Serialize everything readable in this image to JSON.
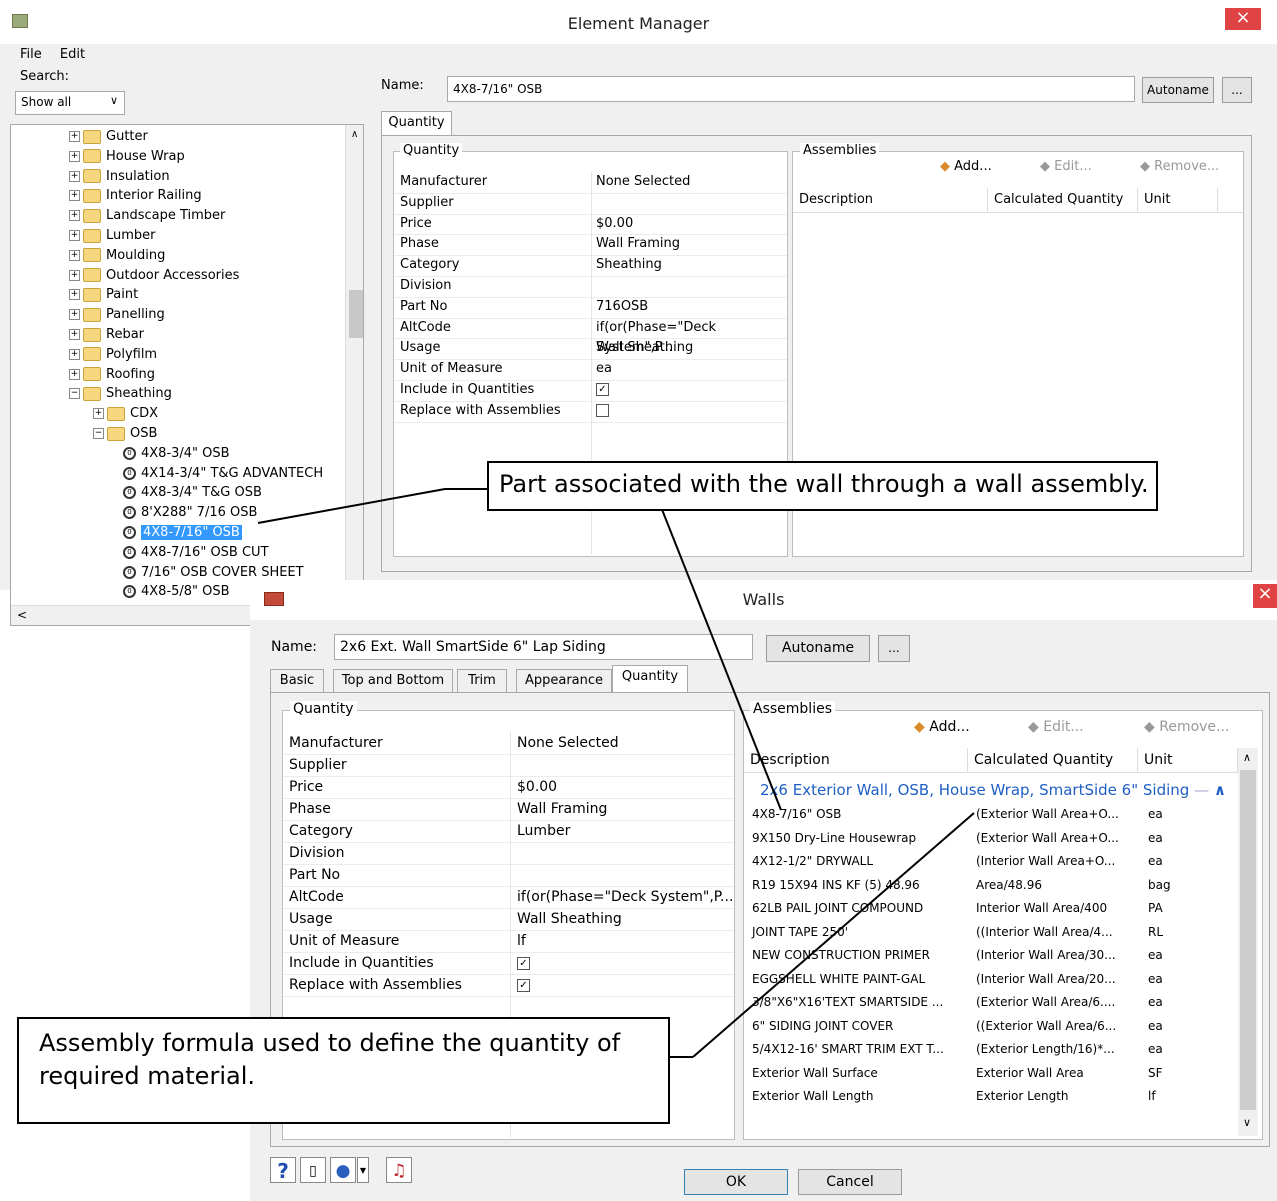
{
  "element_manager": {
    "title": "Element Manager",
    "menu": [
      "File",
      "Edit"
    ],
    "search_label": "Search:",
    "search_filter": "Show all",
    "name_label": "Name:",
    "name_value": "4X8-7/16\" OSB",
    "autoname": "Autoname",
    "ellipsis": "...",
    "tab": "Quantity",
    "quantity_group": "Quantity",
    "assemblies_group": "Assemblies",
    "add": "Add...",
    "edit": "Edit...",
    "remove": "Remove...",
    "col_description": "Description",
    "col_quantity": "Calculated Quantity",
    "col_unit": "Unit",
    "properties": [
      {
        "name": "Manufacturer",
        "value": "None Selected"
      },
      {
        "name": "Supplier",
        "value": ""
      },
      {
        "name": "Price",
        "value": "$0.00"
      },
      {
        "name": "Phase",
        "value": "Wall Framing"
      },
      {
        "name": "Category",
        "value": "Sheathing"
      },
      {
        "name": "Division",
        "value": ""
      },
      {
        "name": "Part No",
        "value": "716OSB"
      },
      {
        "name": "AltCode",
        "value": "if(or(Phase=\"Deck System\",P..."
      },
      {
        "name": "Usage",
        "value": "Wall Sheathing"
      },
      {
        "name": "Unit of Measure",
        "value": "ea"
      },
      {
        "name": "Include in Quantities",
        "value": "",
        "checkbox": true,
        "checked": true
      },
      {
        "name": "Replace with Assemblies",
        "value": "",
        "checkbox": true,
        "checked": false
      }
    ],
    "tree": [
      {
        "label": "Gutter",
        "type": "folder",
        "expander": "+"
      },
      {
        "label": "House Wrap",
        "type": "folder",
        "expander": "+"
      },
      {
        "label": "Insulation",
        "type": "folder",
        "expander": "+"
      },
      {
        "label": "Interior Railing",
        "type": "folder",
        "expander": "+"
      },
      {
        "label": "Landscape Timber",
        "type": "folder",
        "expander": "+"
      },
      {
        "label": "Lumber",
        "type": "folder",
        "expander": "+"
      },
      {
        "label": "Moulding",
        "type": "folder",
        "expander": "+"
      },
      {
        "label": "Outdoor Accessories",
        "type": "folder",
        "expander": "+"
      },
      {
        "label": "Paint",
        "type": "folder",
        "expander": "+"
      },
      {
        "label": "Panelling",
        "type": "folder",
        "expander": "+"
      },
      {
        "label": "Rebar",
        "type": "folder",
        "expander": "+"
      },
      {
        "label": "Polyfilm",
        "type": "folder",
        "expander": "+"
      },
      {
        "label": "Roofing",
        "type": "folder",
        "expander": "+"
      },
      {
        "label": "Sheathing",
        "type": "folder",
        "expander": "-"
      },
      {
        "label": "CDX",
        "type": "folder",
        "expander": "+",
        "level": 2
      },
      {
        "label": "OSB",
        "type": "folder",
        "expander": "-",
        "level": 2
      },
      {
        "label": "4X8-3/4\" OSB",
        "type": "part",
        "level": 3
      },
      {
        "label": "4X14-3/4\" T&G ADVANTECH",
        "type": "part",
        "level": 3
      },
      {
        "label": "4X8-3/4\" T&G OSB",
        "type": "part",
        "level": 3
      },
      {
        "label": "8'X288\" 7/16 OSB",
        "type": "part",
        "level": 3
      },
      {
        "label": "4X8-7/16\" OSB",
        "type": "part",
        "level": 3,
        "selected": true
      },
      {
        "label": "4X8-7/16\" OSB CUT",
        "type": "part",
        "level": 3
      },
      {
        "label": "7/16\" OSB COVER SHEET",
        "type": "part",
        "level": 3
      },
      {
        "label": "4X8-5/8\" OSB",
        "type": "part",
        "level": 3
      }
    ]
  },
  "walls": {
    "title": "Walls",
    "name_label": "Name:",
    "name_value": "2x6 Ext. Wall SmartSide 6\" Lap Siding",
    "autoname": "Autoname",
    "ellipsis": "...",
    "tabs": [
      "Basic",
      "Top and Bottom",
      "Trim",
      "Appearance",
      "Quantity"
    ],
    "active_tab": "Quantity",
    "quantity_group": "Quantity",
    "assemblies_group": "Assemblies",
    "add": "Add...",
    "edit": "Edit...",
    "remove": "Remove...",
    "col_description": "Description",
    "col_quantity": "Calculated Quantity",
    "col_unit": "Unit",
    "assembly_header": "2x6 Exterior Wall, OSB, House Wrap, SmartSide 6\" Siding",
    "properties": [
      {
        "name": "Manufacturer",
        "value": "None Selected"
      },
      {
        "name": "Supplier",
        "value": ""
      },
      {
        "name": "Price",
        "value": "$0.00"
      },
      {
        "name": "Phase",
        "value": "Wall Framing"
      },
      {
        "name": "Category",
        "value": "Lumber"
      },
      {
        "name": "Division",
        "value": ""
      },
      {
        "name": "Part No",
        "value": ""
      },
      {
        "name": "AltCode",
        "value": "if(or(Phase=\"Deck System\",P..."
      },
      {
        "name": "Usage",
        "value": "Wall Sheathing"
      },
      {
        "name": "Unit of Measure",
        "value": "lf"
      },
      {
        "name": "Include in Quantities",
        "value": "",
        "checkbox": true,
        "checked": true
      },
      {
        "name": "Replace with Assemblies",
        "value": "",
        "checkbox": true,
        "checked": true
      }
    ],
    "assembly_rows": [
      {
        "description": "4X8-7/16\" OSB",
        "quantity": "(Exterior Wall Area+O...",
        "unit": "ea"
      },
      {
        "description": "9X150 Dry-Line Housewrap",
        "quantity": "(Exterior Wall Area+O...",
        "unit": "ea"
      },
      {
        "description": "4X12-1/2\" DRYWALL",
        "quantity": "(Interior Wall Area+O...",
        "unit": "ea"
      },
      {
        "description": "R19 15X94 INS KF (5) 48.96",
        "quantity": "Area/48.96",
        "unit": "bag"
      },
      {
        "description": "62LB PAIL JOINT COMPOUND",
        "quantity": "Interior Wall Area/400",
        "unit": "PA"
      },
      {
        "description": "JOINT TAPE 250'",
        "quantity": "((Interior Wall Area/4...",
        "unit": "RL"
      },
      {
        "description": "NEW CONSTRUCTION PRIMER",
        "quantity": "(Interior Wall Area/30...",
        "unit": "ea"
      },
      {
        "description": "EGGSHELL WHITE PAINT-GAL",
        "quantity": "(Interior Wall Area/20...",
        "unit": "ea"
      },
      {
        "description": "3/8\"X6\"X16'TEXT SMARTSIDE ...",
        "quantity": "(Exterior Wall Area/6....",
        "unit": "ea"
      },
      {
        "description": "6\" SIDING JOINT COVER",
        "quantity": "((Exterior Wall Area/6...",
        "unit": "ea"
      },
      {
        "description": "5/4X12-16' SMART TRIM EXT T...",
        "quantity": "(Exterior Length/16)*...",
        "unit": "ea"
      },
      {
        "description": "Exterior Wall Surface",
        "quantity": "Exterior Wall Area",
        "unit": "SF"
      },
      {
        "description": "Exterior Wall Length",
        "quantity": "Exterior Length",
        "unit": "lf"
      }
    ],
    "ok": "OK",
    "cancel": "Cancel"
  },
  "callouts": {
    "part": "Part associated with the wall through a wall assembly.",
    "formula": "Assembly formula used to define the quantity of required material."
  },
  "colors": {
    "selection": "#3399ff",
    "assembly_link": "#1f5fc4",
    "close": "#e04343"
  }
}
